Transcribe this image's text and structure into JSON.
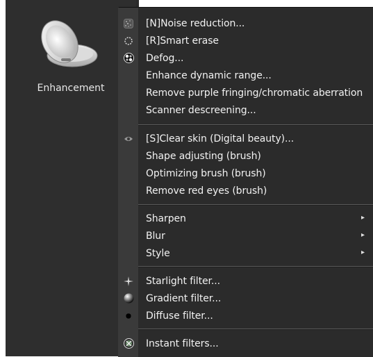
{
  "sidebar": {
    "label": "Enhancement",
    "icon": "compact-mirror-icon"
  },
  "menu": {
    "items": [
      {
        "label": "[N]Noise reduction...",
        "icon": "noise-icon"
      },
      {
        "label": "[R]Smart erase",
        "icon": "smart-erase-icon"
      },
      {
        "label": "Defog...",
        "icon": "defog-icon"
      },
      {
        "label": "Enhance dynamic range..."
      },
      {
        "label": "Remove purple fringing/chromatic aberration"
      },
      {
        "label": "Scanner descreening..."
      },
      {
        "label": "[S]Clear skin (Digital beauty)...",
        "icon": "eye-icon"
      },
      {
        "label": "Shape adjusting (brush)"
      },
      {
        "label": "Optimizing brush (brush)"
      },
      {
        "label": "Remove red eyes (brush)"
      },
      {
        "label": "Sharpen",
        "submenu": true
      },
      {
        "label": "Blur",
        "submenu": true
      },
      {
        "label": "Style",
        "submenu": true
      },
      {
        "label": "Starlight filter...",
        "icon": "starlight-icon"
      },
      {
        "label": "Gradient filter...",
        "icon": "gradient-icon"
      },
      {
        "label": "Diffuse filter...",
        "icon": "diffuse-icon"
      },
      {
        "label": "Instant filters...",
        "icon": "instant-filters-icon"
      }
    ]
  },
  "colors": {
    "sidebar_bg": "#2e2e2e",
    "menu_bg": "#2b2b2b",
    "gutter_bg": "#3a3a3a",
    "text": "#f2f2f2"
  }
}
